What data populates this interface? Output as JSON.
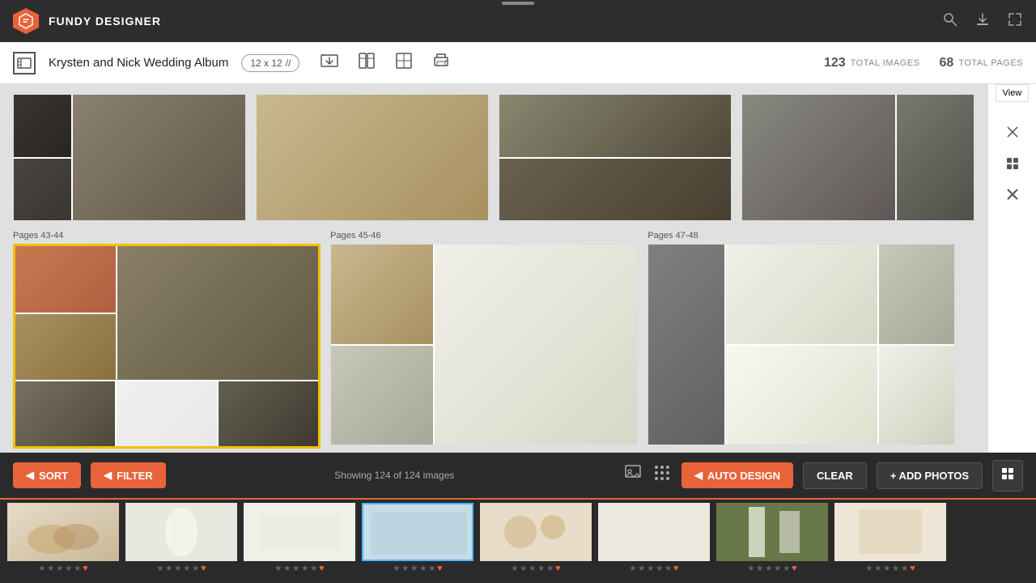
{
  "app": {
    "name": "FUNDY DESIGNER"
  },
  "header": {
    "album_title": "Krysten and Nick Wedding Album",
    "size": "12 x 12",
    "total_images_count": "123",
    "total_images_label": "TOTAL IMAGES",
    "total_pages_count": "68",
    "total_pages_label": "TOTAL PAGES"
  },
  "toolbar": {
    "sort_label": "SORT",
    "filter_label": "FILTER",
    "showing_text": "Showing 124 of 124 images",
    "auto_design_label": "AUTO DESIGN",
    "clear_label": "CLEAR",
    "add_photos_label": "+ ADD PHOTOS",
    "view_label": "View"
  },
  "pages": [
    {
      "label": "Pages 43-44",
      "selected": true
    },
    {
      "label": "Pages 45-46",
      "selected": false
    },
    {
      "label": "Pages 47-48",
      "selected": false
    }
  ],
  "strip_photos": [
    {
      "type": "beige",
      "rating": 0
    },
    {
      "type": "white",
      "rating": 0
    },
    {
      "type": "white2",
      "rating": 0
    },
    {
      "type": "blue",
      "rating": 0,
      "selected": true
    },
    {
      "type": "floral",
      "rating": 0
    },
    {
      "type": "blank",
      "rating": 0
    },
    {
      "type": "garden",
      "rating": 0
    },
    {
      "type": "white3",
      "rating": 0
    }
  ],
  "icons": {
    "sort_arrow": "◀",
    "filter_arrow": "◀",
    "auto_design_arrow": "◀",
    "add_icon": "+",
    "grid_icon": "⊞",
    "chevron_left": "‹",
    "chevron_right": "›",
    "star_empty": "★",
    "heart": "♥",
    "search": "🔍",
    "download": "⬇",
    "expand": "⛶",
    "fundy_logo": "F",
    "album_icon": "📷",
    "drag_icon": "⊞",
    "pages_icon": "⊟",
    "layout_icon": "⊠",
    "print_icon": "⊛"
  },
  "colors": {
    "orange": "#e8633a",
    "yellow_selected": "#f0c200",
    "dark_bg": "#2a2a2a",
    "header_bg": "#ffffff",
    "topbar_bg": "#2d2d2d"
  }
}
